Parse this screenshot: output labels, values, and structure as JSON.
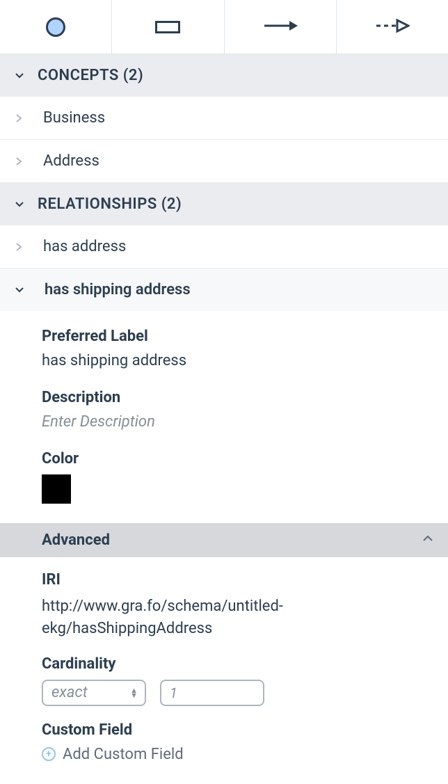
{
  "toolbar": {
    "items": [
      "circle",
      "rectangle",
      "solid-arrow",
      "dashed-arrow"
    ]
  },
  "sections": {
    "concepts": {
      "label": "CONCEPTS (2)",
      "items": [
        "Business",
        "Address"
      ]
    },
    "relationships": {
      "label": "RELATIONSHIPS (2)",
      "items": [
        "has address",
        "has shipping address"
      ]
    }
  },
  "detail": {
    "preferred_label_title": "Preferred Label",
    "preferred_label_value": "has shipping address",
    "description_title": "Description",
    "description_placeholder": "Enter Description",
    "color_title": "Color",
    "color_value": "#000000",
    "advanced_title": "Advanced",
    "iri_title": "IRI",
    "iri_value": "http://www.gra.fo/schema/untitled-ekg/hasShippingAddress",
    "cardinality_title": "Cardinality",
    "cardinality_mode": "exact",
    "cardinality_value": "1",
    "custom_field_title": "Custom Field",
    "add_custom_label": "Add Custom Field"
  }
}
